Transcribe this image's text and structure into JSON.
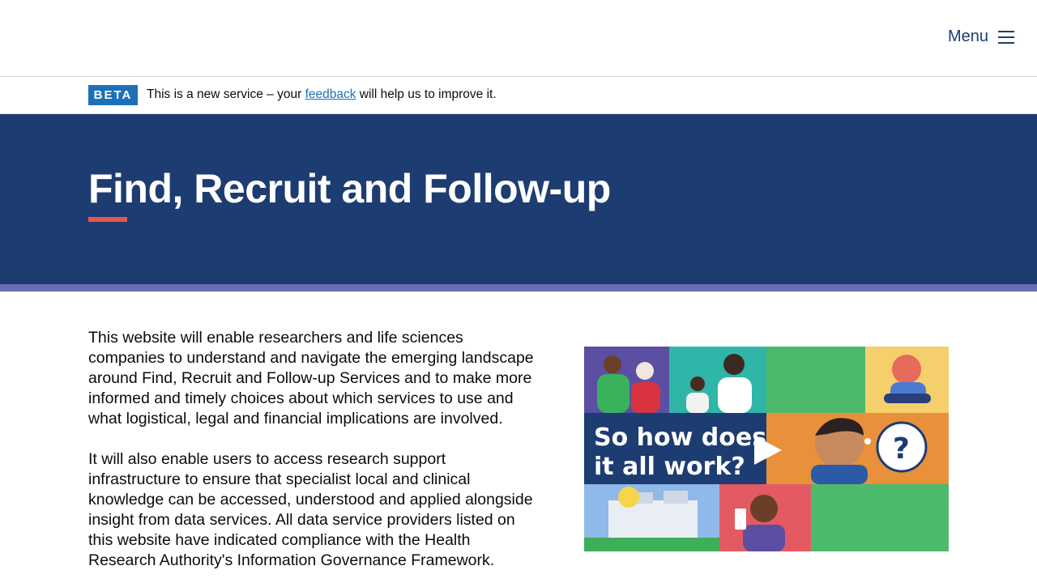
{
  "header": {
    "menu_label": "Menu",
    "menu_icon": "hamburger-icon"
  },
  "beta": {
    "tag": "BETA",
    "text_before": "This is a new service – your",
    "link": "feedback",
    "text_after": "will help us to improve it."
  },
  "hero": {
    "title": "Find, Recruit and Follow-up"
  },
  "intro": {
    "paragraphs": [
      "This website will enable researchers and life sciences companies to understand and navigate the emerging landscape around Find, Recruit and Follow-up Services and to make more informed and timely choices about which services to use and what logistical, legal and financial implications are involved.",
      "It will also enable users to access research support infrastructure to ensure that specialist local and clinical knowledge can be accessed, understood and applied alongside insight from data services. All data service providers listed on this website have indicated compliance with the Health Research Authority's Information Governance Framework."
    ]
  },
  "video": {
    "caption_line1": "So how does",
    "caption_line2": "it all work?",
    "play_icon": "play-icon"
  },
  "colors": {
    "navy": "#1d3c72",
    "beta_blue": "#1d70b8",
    "accent_red": "#e8574a",
    "stripe_purple": "#6a6db4"
  }
}
